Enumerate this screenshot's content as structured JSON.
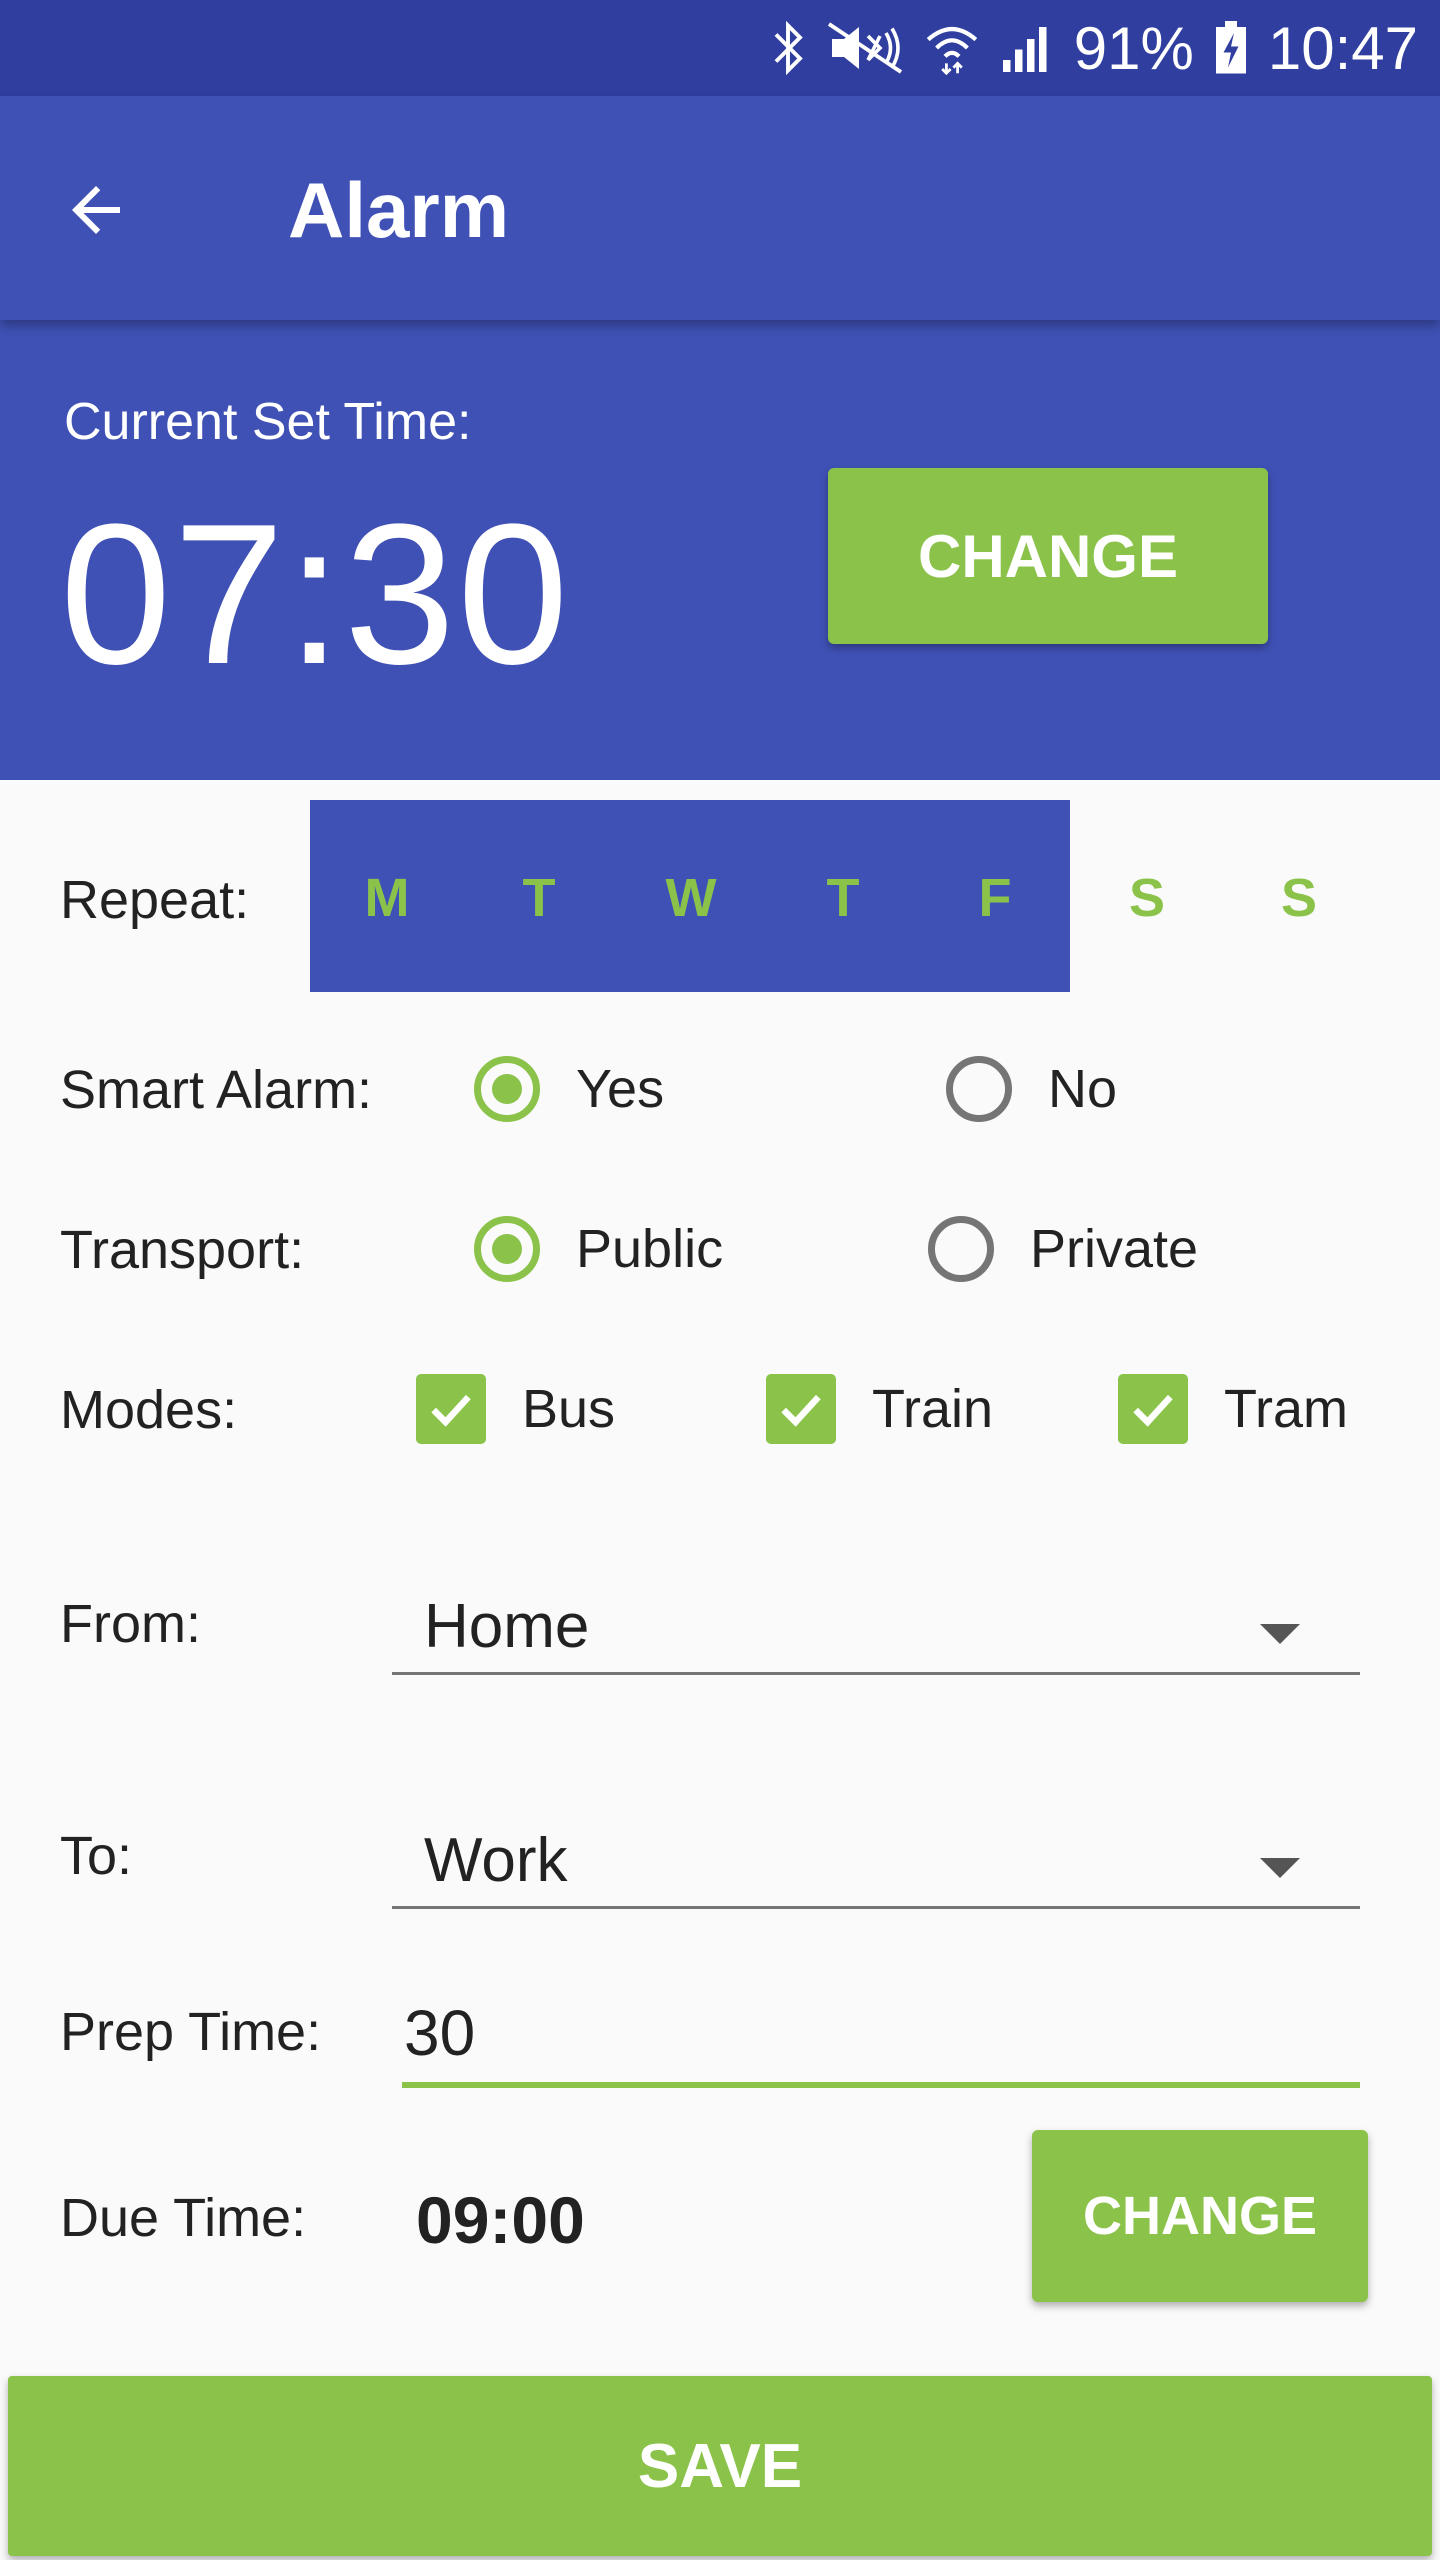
{
  "status_bar": {
    "battery": "91%",
    "time": "10:47",
    "icons": [
      "bluetooth-icon",
      "mute-icon",
      "wifi-icon",
      "signal-icon",
      "battery-icon"
    ]
  },
  "app_bar": {
    "title": "Alarm",
    "back_icon": "arrow-left-icon"
  },
  "current_time": {
    "label": "Current Set Time:",
    "value": "07:30",
    "change_label": "CHANGE"
  },
  "repeat": {
    "label": "Repeat:",
    "days": [
      {
        "letter": "M",
        "selected": true
      },
      {
        "letter": "T",
        "selected": true
      },
      {
        "letter": "W",
        "selected": true
      },
      {
        "letter": "T",
        "selected": true
      },
      {
        "letter": "F",
        "selected": true
      },
      {
        "letter": "S",
        "selected": false
      },
      {
        "letter": "S",
        "selected": false
      }
    ]
  },
  "smart_alarm": {
    "label": "Smart Alarm:",
    "options": [
      "Yes",
      "No"
    ],
    "selected": "Yes"
  },
  "transport": {
    "label": "Transport:",
    "options": [
      "Public",
      "Private"
    ],
    "selected": "Public"
  },
  "modes": {
    "label": "Modes:",
    "items": [
      {
        "label": "Bus",
        "checked": true
      },
      {
        "label": "Train",
        "checked": true
      },
      {
        "label": "Tram",
        "checked": true
      }
    ]
  },
  "from": {
    "label": "From:",
    "value": "Home"
  },
  "to": {
    "label": "To:",
    "value": "Work"
  },
  "prep_time": {
    "label": "Prep Time:",
    "value": "30"
  },
  "due_time": {
    "label": "Due Time:",
    "value": "09:00",
    "change_label": "CHANGE"
  },
  "save_label": "SAVE",
  "colors": {
    "primary": "#3f51b5",
    "primary_dark": "#303f9f",
    "accent": "#8bc34a"
  }
}
